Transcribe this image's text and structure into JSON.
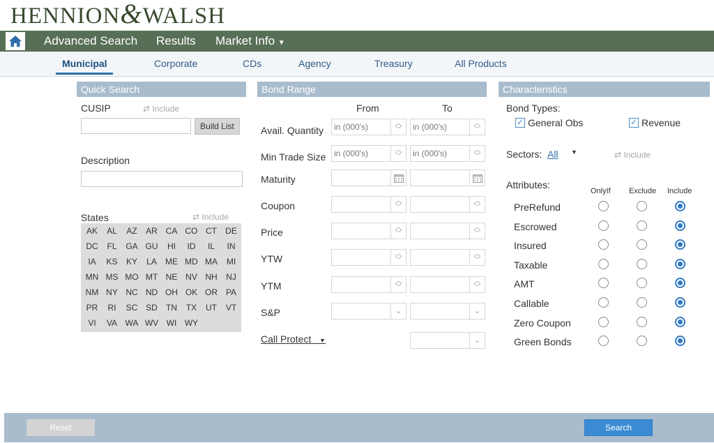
{
  "logo": {
    "part1": "HENNION",
    "amp": "&",
    "part2": "WALSH"
  },
  "nav": {
    "items": [
      "Advanced Search",
      "Results",
      "Market Info"
    ]
  },
  "subnav": {
    "items": [
      "Municipal",
      "Corporate",
      "CDs",
      "Agency",
      "Treasury",
      "All Products"
    ]
  },
  "quick": {
    "title": "Quick Search",
    "cusip": "CUSIP",
    "include": "Include",
    "build": "Build List",
    "description": "Description",
    "states_label": "States",
    "states": [
      "AK",
      "AL",
      "AZ",
      "AR",
      "CA",
      "CO",
      "CT",
      "DE",
      "DC",
      "FL",
      "GA",
      "GU",
      "HI",
      "ID",
      "IL",
      "IN",
      "IA",
      "KS",
      "KY",
      "LA",
      "ME",
      "MD",
      "MA",
      "MI",
      "MN",
      "MS",
      "MO",
      "MT",
      "NE",
      "NV",
      "NH",
      "NJ",
      "NM",
      "NY",
      "NC",
      "ND",
      "OH",
      "OK",
      "OR",
      "PA",
      "PR",
      "RI",
      "SC",
      "SD",
      "TN",
      "TX",
      "UT",
      "VT",
      "VI",
      "VA",
      "WA",
      "WV",
      "WI",
      "WY"
    ]
  },
  "range": {
    "title": "Bond Range",
    "from": "From",
    "to": "To",
    "placeholder": "in (000's)",
    "rows": [
      "Avail. Quantity",
      "Min Trade Size",
      "Maturity",
      "Coupon",
      "Price",
      "YTW",
      "YTM",
      "S&P"
    ],
    "call_protect": "Call Protect"
  },
  "chars": {
    "title": "Characteristics",
    "bond_types": "Bond Types:",
    "general_obs": "General Obs",
    "revenue": "Revenue",
    "sectors": "Sectors:",
    "sectors_value": "All",
    "include": "Include",
    "attributes": "Attributes:",
    "cols": [
      "OnlyIf",
      "Exclude",
      "Include"
    ],
    "attrs": [
      "PreRefund",
      "Escrowed",
      "Insured",
      "Taxable",
      "AMT",
      "Callable",
      "Zero Coupon",
      "Green Bonds"
    ]
  },
  "footer": {
    "reset": "Reset",
    "search": "Search"
  },
  "colors": {
    "nav": "#586f57",
    "section": "#a9bccd",
    "accent": "#2f7ac2"
  }
}
